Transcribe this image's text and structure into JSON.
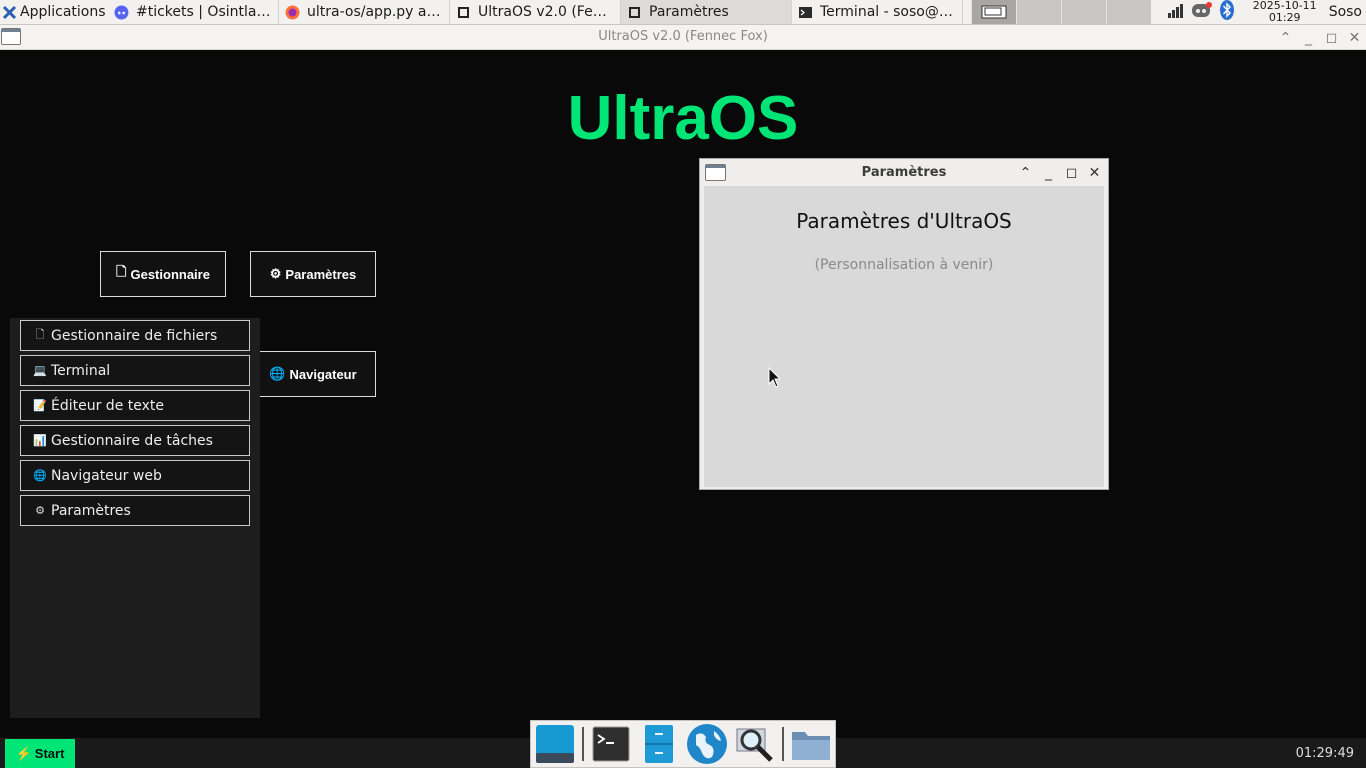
{
  "top_panel": {
    "applications_label": "Applications",
    "tasks": [
      {
        "label": "#tickets | Osintlab ...",
        "icon": "discord-icon",
        "active": false
      },
      {
        "label": "ultra-os/app.py at ...",
        "icon": "firefox-icon",
        "active": false
      },
      {
        "label": "UltraOS v2.0 (Fenn...",
        "icon": "window-icon",
        "active": false
      },
      {
        "label": "Paramètres",
        "icon": "window-icon",
        "active": true
      },
      {
        "label": "Terminal - soso@So...",
        "icon": "terminal-icon",
        "active": false
      }
    ],
    "clock_date": "2025-10-11",
    "clock_time": "01:29",
    "user": "Soso"
  },
  "main_window": {
    "title": "UltraOS v2.0 (Fennec Fox)"
  },
  "desktop": {
    "title": "UltraOS",
    "buttons": {
      "files": {
        "icon": "🗋",
        "label": "Gestionnaire"
      },
      "settings": {
        "icon": "⚙",
        "label": "Paramètres"
      },
      "browser": {
        "icon": "🌐",
        "label": "Navigateur"
      }
    },
    "start_menu": [
      {
        "icon": "🗋",
        "label": "Gestionnaire de fichiers"
      },
      {
        "icon": "💻",
        "label": "Terminal"
      },
      {
        "icon": "📝",
        "label": "Éditeur de texte"
      },
      {
        "icon": "📊",
        "label": "Gestionnaire de tâches"
      },
      {
        "icon": "🌐",
        "label": "Navigateur web"
      },
      {
        "icon": "⚙",
        "label": "Paramètres"
      }
    ]
  },
  "settings_window": {
    "title": "Paramètres",
    "heading": "Paramètres d'UltraOS",
    "subtitle": "(Personnalisation à venir)"
  },
  "bottom_bar": {
    "start_icon": "⚡",
    "start_label": "Start",
    "clock": "01:29:49"
  },
  "dock": [
    "desktop-icon",
    "terminal-icon",
    "file-cabinet-icon",
    "web-browser-icon",
    "search-icon",
    "folder-icon"
  ],
  "colors": {
    "accent": "#00e676",
    "desktop_bg": "#090909",
    "menu_bg": "#1d1d1d"
  }
}
